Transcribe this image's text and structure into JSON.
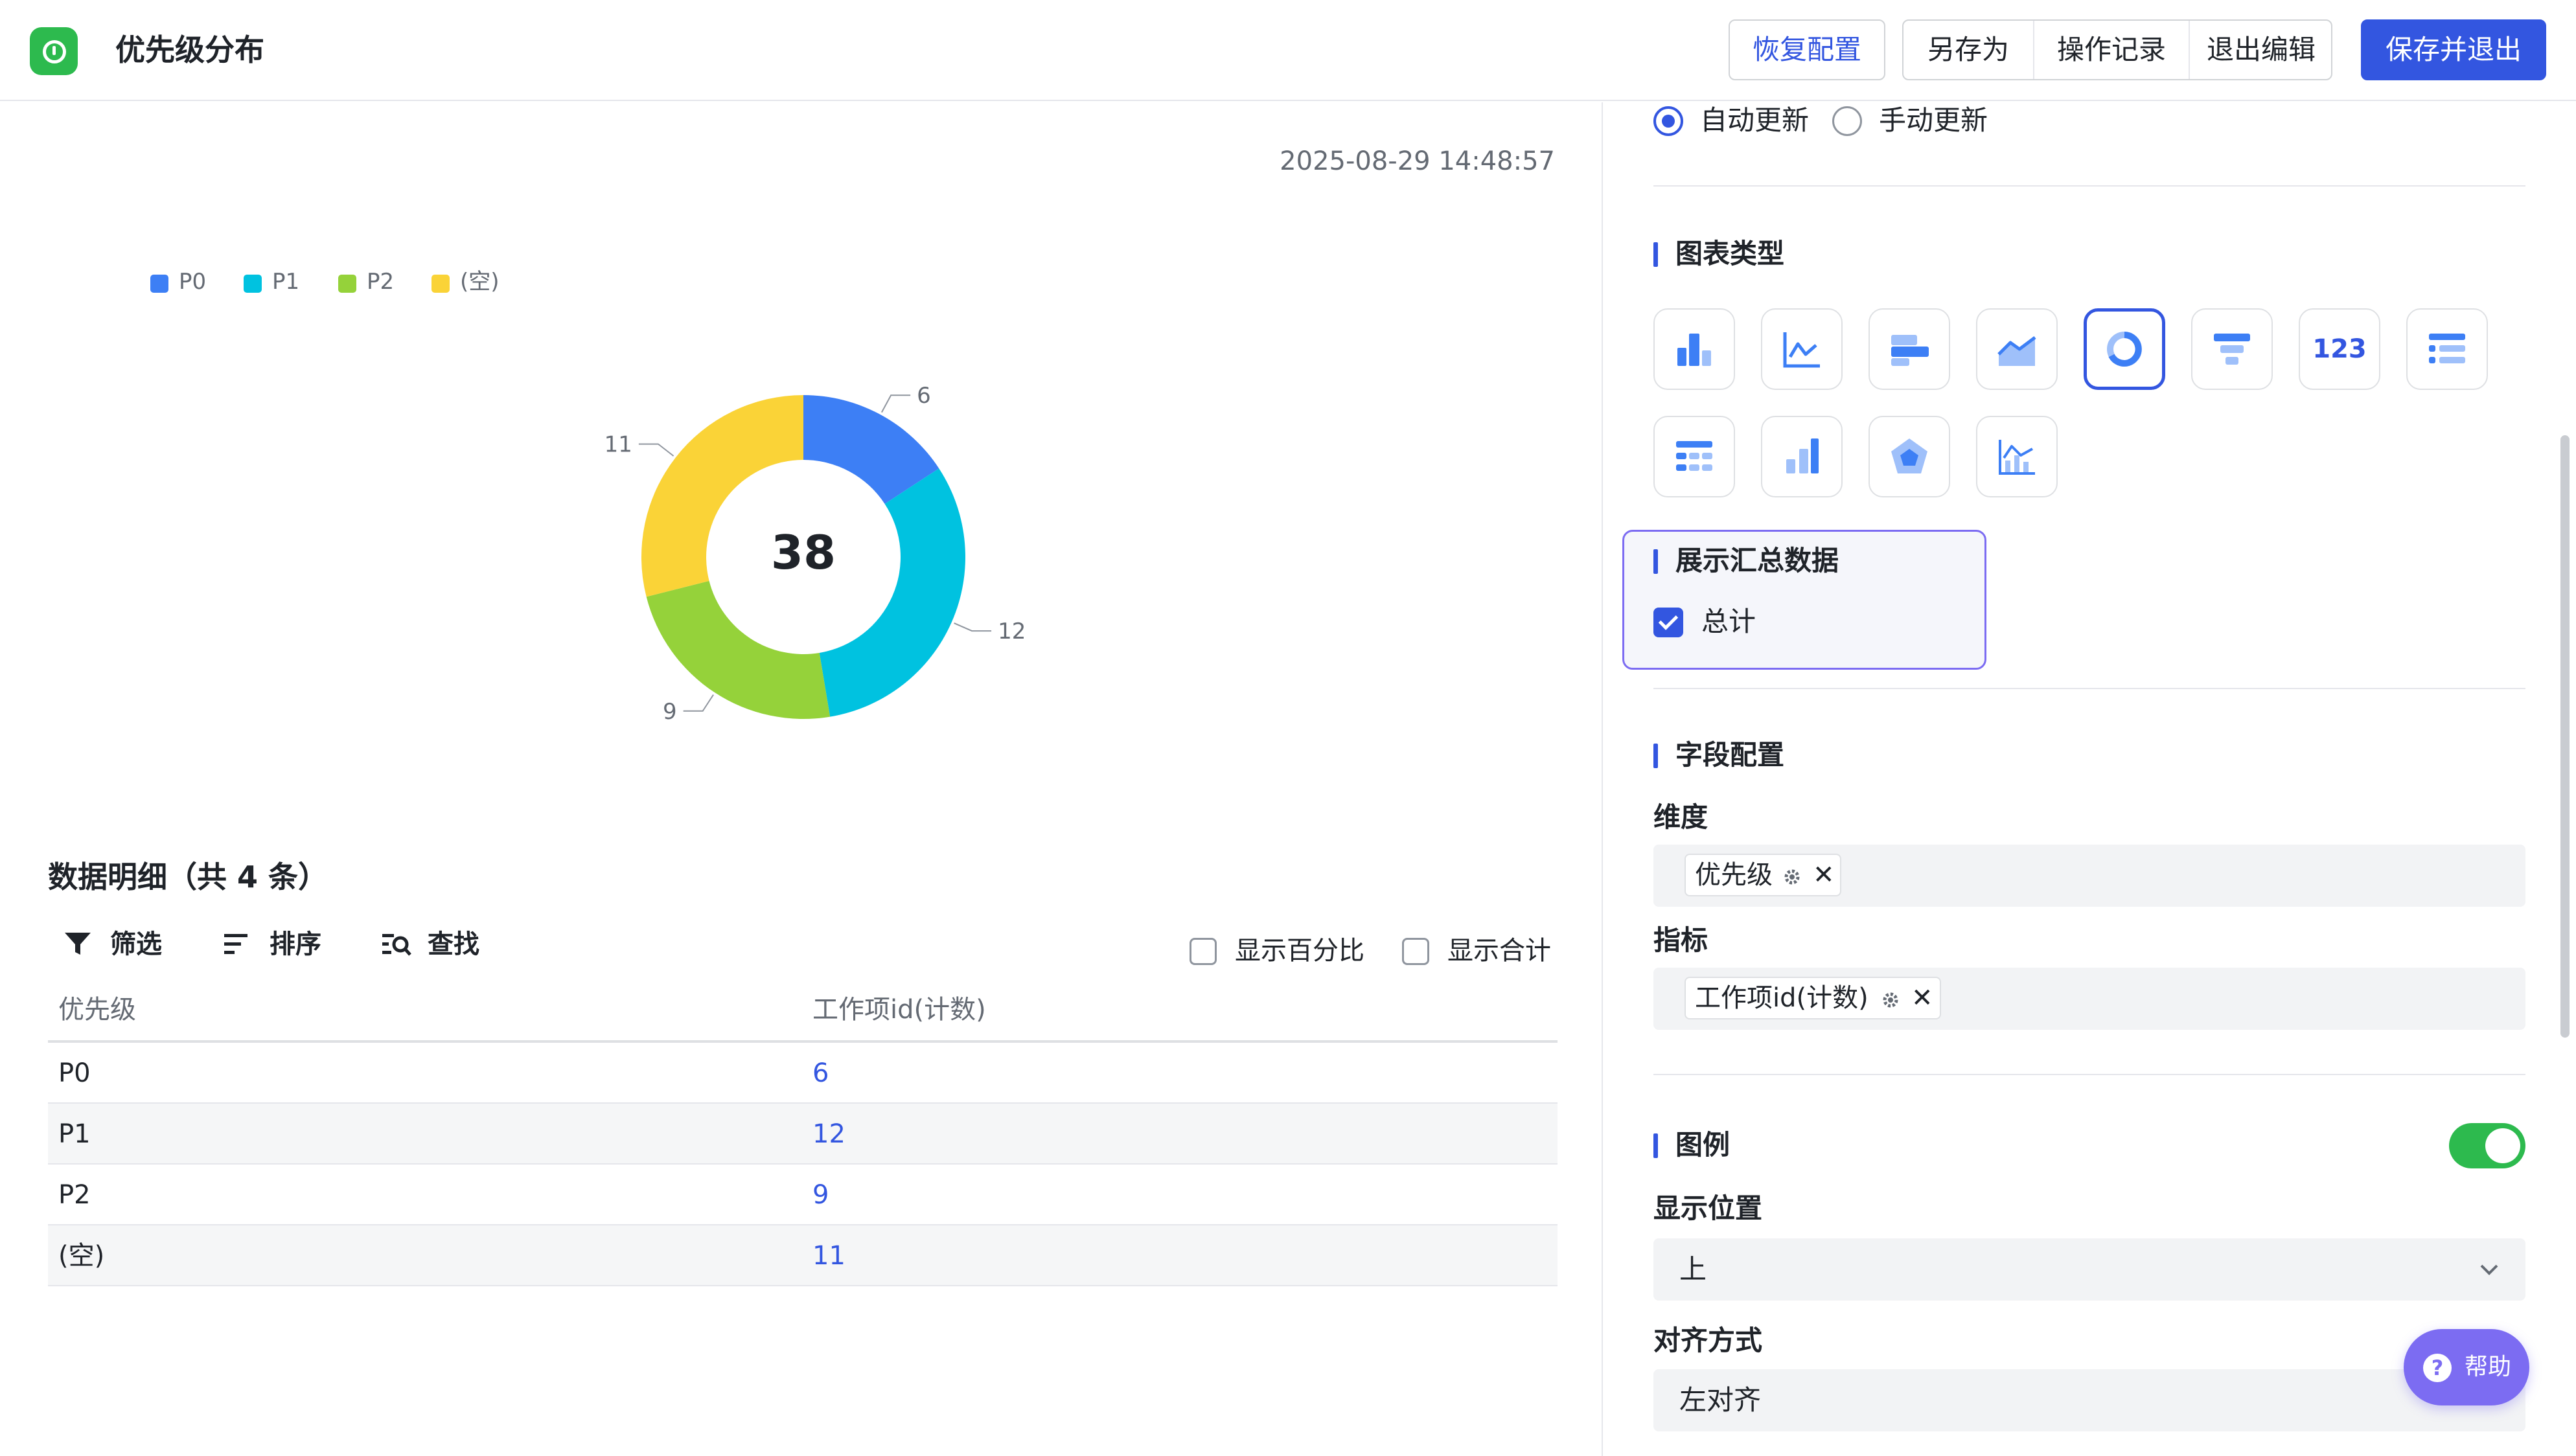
{
  "header": {
    "title": "优先级分布",
    "restore_label": "恢复配置",
    "save_as_label": "另存为",
    "history_label": "操作记录",
    "exit_edit_label": "退出编辑",
    "save_exit_label": "保存并退出"
  },
  "chart_panel": {
    "timestamp": "2025-08-29 14:48:57",
    "center_total": "38"
  },
  "chart_data": {
    "type": "pie",
    "donut": true,
    "categories": [
      "P0",
      "P1",
      "P2",
      "(空)"
    ],
    "values": [
      6,
      12,
      9,
      11
    ],
    "colors": [
      "#3d7ff5",
      "#00c2e0",
      "#95d23a",
      "#fad337"
    ],
    "total": 38,
    "legend_position": "top-left",
    "data_labels": [
      "6",
      "12",
      "9",
      "11"
    ]
  },
  "detail": {
    "title": "数据明细（共 4 条）",
    "toolbar": {
      "filter_label": "筛选",
      "sort_label": "排序",
      "find_label": "查找"
    },
    "show_percent_label": "显示百分比",
    "show_total_label": "显示合计",
    "columns": [
      "优先级",
      "工作项id(计数)"
    ],
    "rows": [
      [
        "P0",
        "6"
      ],
      [
        "P1",
        "12"
      ],
      [
        "P2",
        "9"
      ],
      [
        "(空)",
        "11"
      ]
    ]
  },
  "config": {
    "auto_update_label": "自动更新",
    "manual_update_label": "手动更新",
    "chart_type_title": "图表类型",
    "chart_types": [
      "bar-chart-icon",
      "line-chart-icon",
      "horizontal-bar-icon",
      "area-chart-icon",
      "donut-chart-icon",
      "funnel-chart-icon",
      "number-card-icon",
      "list-icon",
      "detail-table-icon",
      "combo-bar-icon",
      "radar-chart-icon",
      "dual-axis-icon"
    ],
    "number_card_label": "123",
    "summary_title": "展示汇总数据",
    "summary_total_label": "总计",
    "field_config_title": "字段配置",
    "dimension_label": "维度",
    "dimension_tag": "优先级",
    "metric_label": "指标",
    "metric_tag": "工作项id(计数)",
    "legend_title": "图例",
    "position_label": "显示位置",
    "position_value": "上",
    "align_label": "对齐方式",
    "align_value": "左对齐",
    "help_label": "帮助",
    "accent_color": "#3356e0",
    "toggle_color": "#2dba4e"
  }
}
